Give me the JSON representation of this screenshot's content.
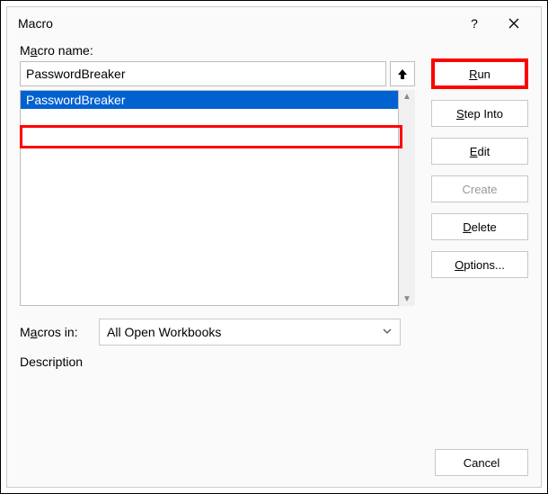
{
  "title": "Macro",
  "help_symbol": "?",
  "macro_name_label_pre": "M",
  "macro_name_label_u": "a",
  "macro_name_label_post": "cro name:",
  "macro_name_value": "PasswordBreaker",
  "list": {
    "items": [
      "PasswordBreaker"
    ]
  },
  "buttons": {
    "run_u": "R",
    "run_post": "un",
    "step_u": "S",
    "step_post": "tep Into",
    "edit_u": "E",
    "edit_post": "dit",
    "create": "Create",
    "delete_u": "D",
    "delete_post": "elete",
    "options_u": "O",
    "options_post": "ptions...",
    "cancel": "Cancel"
  },
  "macros_in_label_pre": "M",
  "macros_in_label_u": "a",
  "macros_in_label_post": "cros in:",
  "macros_in_value": "All Open Workbooks",
  "description_label": "Description"
}
